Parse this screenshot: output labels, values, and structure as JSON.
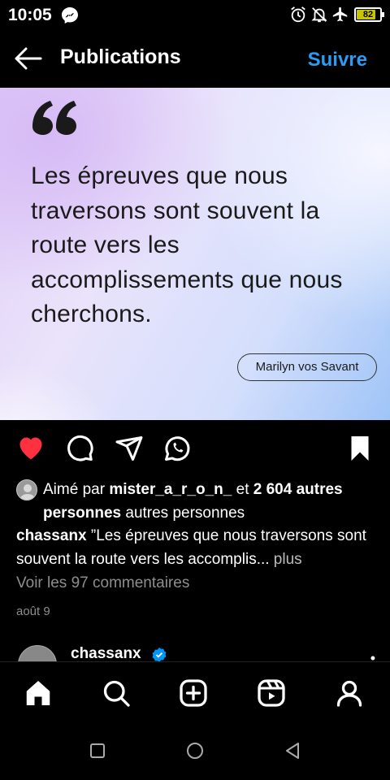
{
  "status_bar": {
    "time": "10:05",
    "battery": "82",
    "battery_level": 0.82,
    "battery_color": "#c9c400"
  },
  "header": {
    "title": "Publications",
    "follow_label": "Suivre",
    "accent_color": "#2b9bf4"
  },
  "post": {
    "quote": "Les épreuves que nous traversons sont souvent la route vers les accomplissements que nous cherchons.",
    "author": "Marilyn vos Savant",
    "liked": true,
    "likes": {
      "prefix": "Aimé par ",
      "user": "mister_a_r_o_n_",
      "connector": " et ",
      "count_label": "2 604 autres personnes",
      "suffix": " autres personnes"
    },
    "caption": {
      "username": "chassanx",
      "text": " ”Les épreuves que nous traversons sont souvent la route vers les accomplis...",
      "more": " plus"
    },
    "view_comments": "Voir les 97 commentaires",
    "date": "août 9"
  },
  "next_post": {
    "username": "chassanx",
    "verified": true
  },
  "icons": {
    "actions": [
      "heart-icon",
      "comment-icon",
      "share-icon",
      "whatsapp-icon",
      "bookmark-icon"
    ],
    "bottom_nav": [
      "home-icon",
      "search-icon",
      "add-post-icon",
      "reels-icon",
      "profile-icon"
    ],
    "system_nav": [
      "recent-apps-icon",
      "home-circle-icon",
      "back-triangle-icon"
    ]
  }
}
